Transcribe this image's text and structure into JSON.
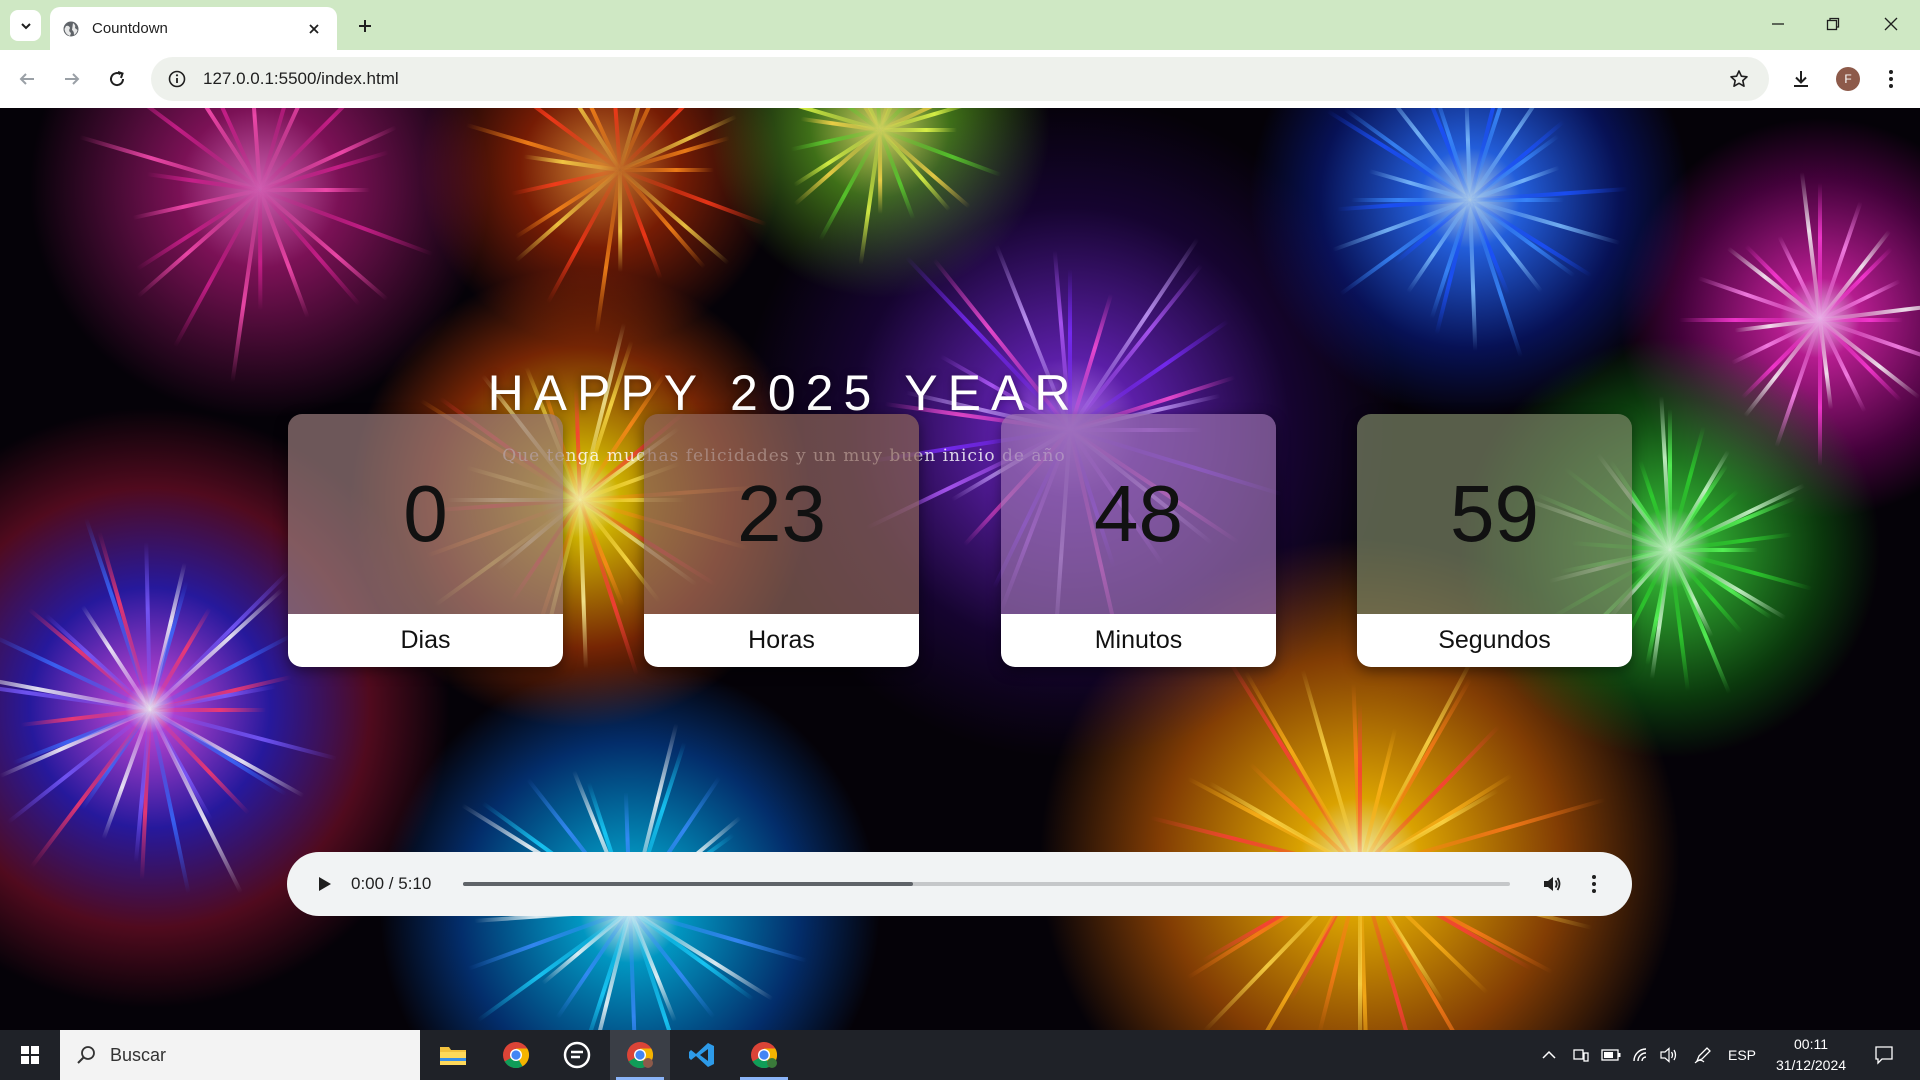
{
  "browser": {
    "tab_title": "Countdown",
    "url": "127.0.0.1:5500/index.html",
    "profile_initial": "F"
  },
  "page": {
    "headline": "HAPPY 2025 YEAR",
    "subline": "Que tenga muchas felicidades y un muy buen inicio de año",
    "countdown": [
      {
        "value": "0",
        "label": "Dias"
      },
      {
        "value": "23",
        "label": "Horas"
      },
      {
        "value": "48",
        "label": "Minutos"
      },
      {
        "value": "59",
        "label": "Segundos"
      }
    ],
    "audio": {
      "time": "0:00 / 5:10",
      "buffered_fraction": 0.43
    }
  },
  "taskbar": {
    "search_placeholder": "Buscar",
    "language": "ESP",
    "time": "00:11",
    "date": "31/12/2024"
  },
  "colors": {
    "tabbar": "#cfe8c4",
    "taskbar": "#1f2228",
    "accent": "#8ab4f8"
  }
}
